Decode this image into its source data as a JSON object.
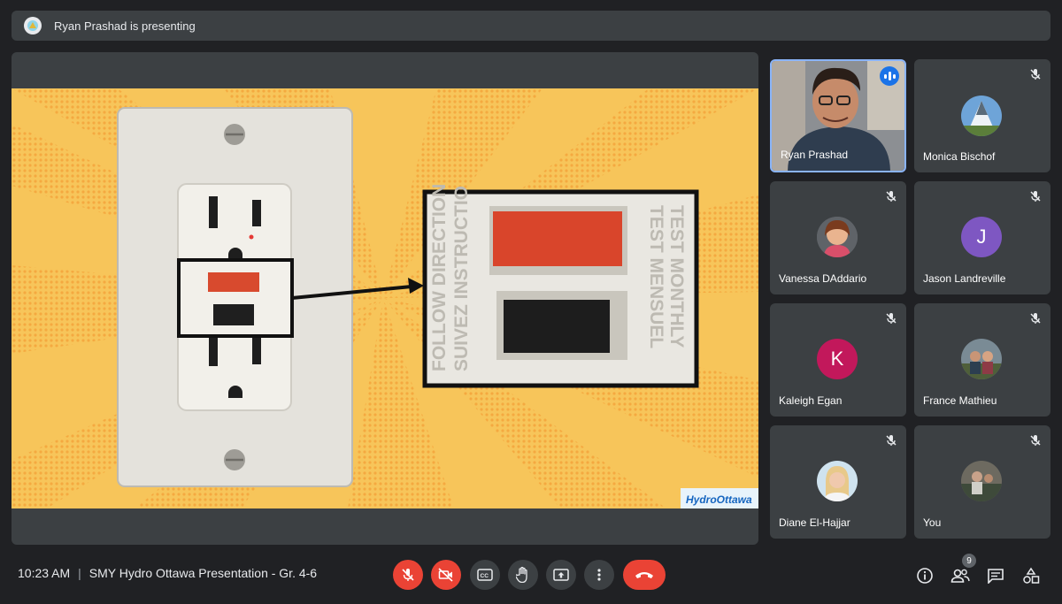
{
  "banner": {
    "text": "Ryan Prashad is presenting"
  },
  "slide": {
    "logo_text": "HydroOttawa"
  },
  "participants": [
    {
      "name": "Ryan Prashad",
      "speaking": true
    },
    {
      "name": "Monica Bischof",
      "muted": true
    },
    {
      "name": "Vanessa DAddario",
      "muted": true
    },
    {
      "name": "Jason Landreville",
      "muted": true,
      "initial": "J",
      "color": "#7e57c2"
    },
    {
      "name": "Kaleigh Egan",
      "muted": true,
      "initial": "K",
      "color": "#c2185b"
    },
    {
      "name": "France Mathieu",
      "muted": true
    },
    {
      "name": "Diane El-Hajjar",
      "muted": true
    },
    {
      "name": "You",
      "muted": true
    }
  ],
  "footer": {
    "time": "10:23 AM",
    "meeting_title": "SMY Hydro Ottawa Presentation - Gr. 4-6",
    "people_count": "9"
  },
  "controls": [
    "mic-off-icon",
    "camera-off-icon",
    "captions-icon",
    "raise-hand-icon",
    "present-icon",
    "more-icon",
    "hang-up-icon"
  ],
  "colors": {
    "accent": "#8ab4f8",
    "danger": "#ea4335",
    "surface": "#3c4043",
    "background": "#202124"
  }
}
